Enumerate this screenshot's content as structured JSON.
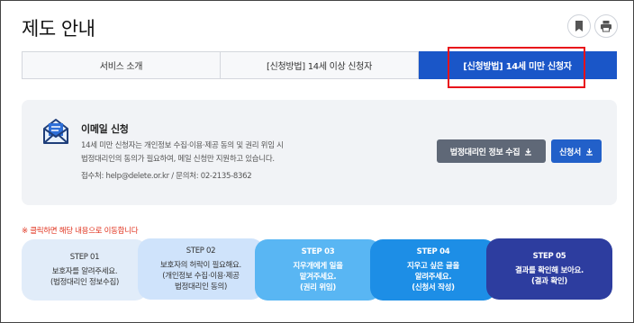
{
  "page": {
    "title": "제도 안내"
  },
  "header_icons": {
    "bookmark": "bookmark-icon",
    "print": "print-icon"
  },
  "tabs": [
    {
      "label": "서비스 소개",
      "active": false
    },
    {
      "label": "[신청방법] 14세 이상 신청자",
      "active": false
    },
    {
      "label": "[신청방법] 14세 미만 신청자",
      "active": true
    }
  ],
  "email_section": {
    "title": "이메일 신청",
    "desc_line1": "14세 미만 신청자는 개인정보 수집·이용·제공 동의 및 권리 위임 시",
    "desc_line2": "법정대리인의 동의가 필요하여, 메일 신청만 지원하고 있습니다.",
    "contact": "접수처: help@delete.or.kr / 문의처: 02-2135-8362",
    "btn_guardian_info": "법정대리인 정보 수집",
    "btn_application": "신청서"
  },
  "notice": "※ 클릭하면 해당 내용으로 이동합니다",
  "steps": [
    {
      "num": "STEP 01",
      "line1": "보호자를 알려주세요.",
      "line2": "(법정대리인 정보수집)",
      "line3": ""
    },
    {
      "num": "STEP 02",
      "line1": "보호자의 허락이 필요해요.",
      "line2": "(개인정보 수집·이용·제공",
      "line3": "법정대리인 동의)"
    },
    {
      "num": "STEP 03",
      "line1": "지우개에게 일을",
      "line2": "맡겨주세요.",
      "line3": "(권리 위임)"
    },
    {
      "num": "STEP 04",
      "line1": "지우고 싶은 글을",
      "line2": "알려주세요.",
      "line3": "(신청서 작성)"
    },
    {
      "num": "STEP 05",
      "line1": "결과를 확인해 보아요.",
      "line2": "(결과 확인)",
      "line3": ""
    }
  ],
  "colors": {
    "primary": "#1a56c8",
    "highlight_box": "#e8121b",
    "notice": "#e0341f",
    "step3": "#59b6f3",
    "step4": "#1d8ee6",
    "step5": "#2d3d9f"
  }
}
